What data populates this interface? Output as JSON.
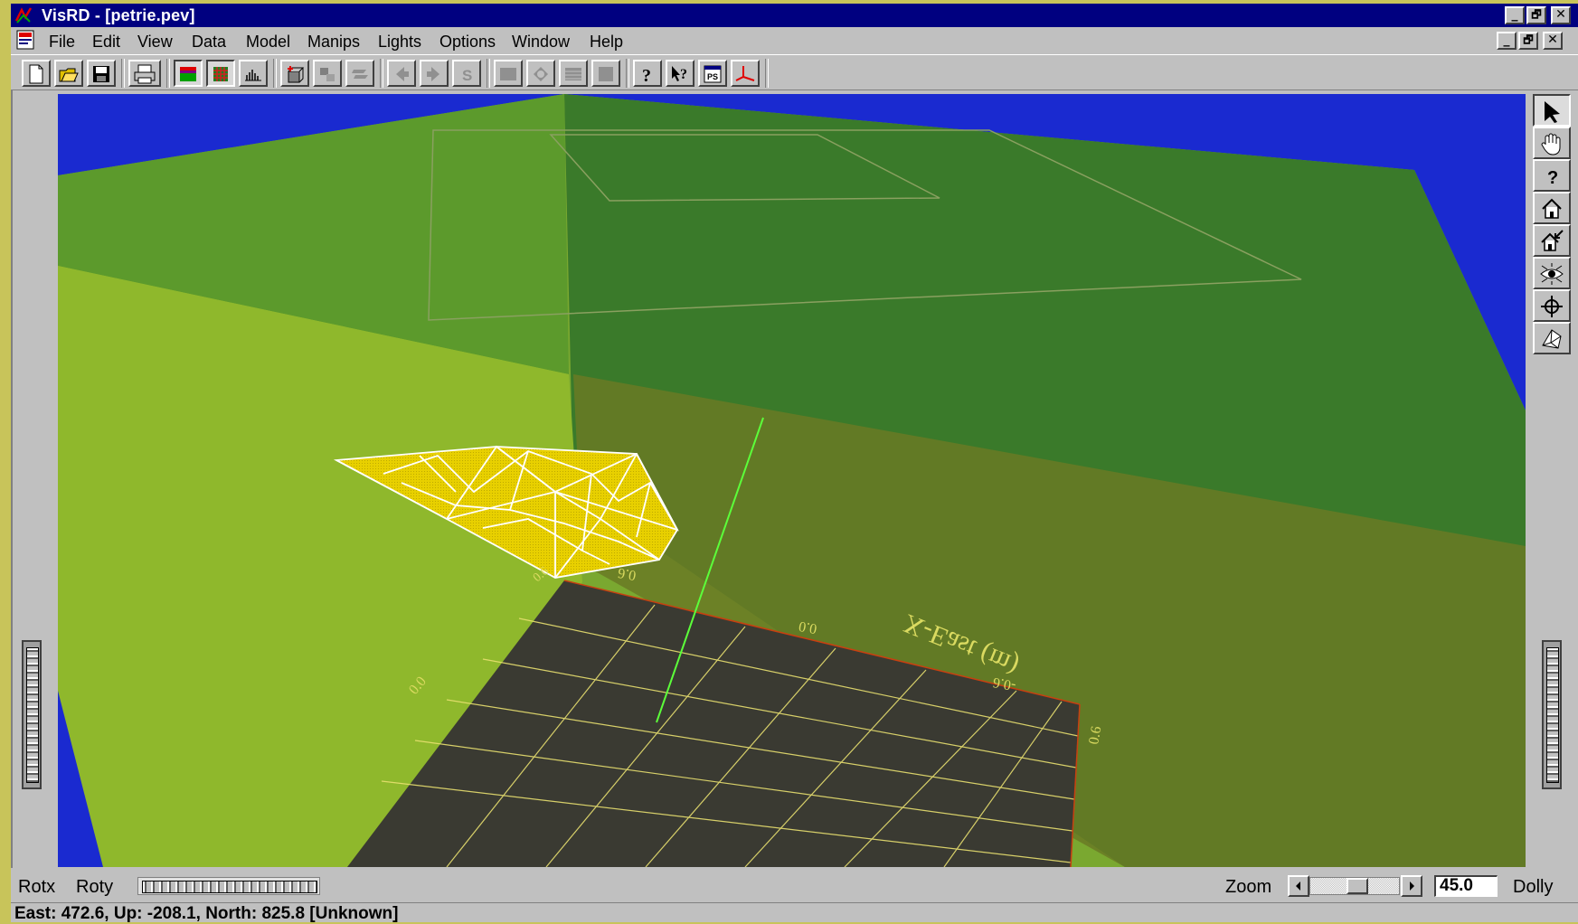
{
  "window": {
    "title": "VisRD - [petrie.pev]",
    "controls": [
      "_",
      "🗗",
      "✕"
    ]
  },
  "menubar": {
    "items": [
      "File",
      "Edit",
      "View",
      "Data",
      "Model",
      "Manips",
      "Lights",
      "Options",
      "Window",
      "Help"
    ],
    "doc_controls": [
      "_",
      "🗗",
      "✕"
    ]
  },
  "toolbar": {
    "buttons": [
      {
        "icon": "new-document-icon"
      },
      {
        "icon": "open-folder-icon"
      },
      {
        "icon": "save-disk-icon"
      },
      {
        "icon": "print-icon"
      },
      {
        "icon": "solid-render-icon",
        "pressed": true
      },
      {
        "icon": "textured-render-icon",
        "pressed": true
      },
      {
        "icon": "histogram-icon"
      },
      {
        "icon": "add-object-icon"
      },
      {
        "icon": "group-objects-icon"
      },
      {
        "icon": "stack-objects-icon"
      },
      {
        "icon": "step-back-icon"
      },
      {
        "icon": "step-forward-icon"
      },
      {
        "icon": "s-icon",
        "text": "S"
      },
      {
        "icon": "rectangle-icon"
      },
      {
        "icon": "shape-icon"
      },
      {
        "icon": "pattern-icon"
      },
      {
        "icon": "square-icon"
      },
      {
        "icon": "help-icon",
        "text": "?"
      },
      {
        "icon": "context-help-icon",
        "text": "?"
      },
      {
        "icon": "postscript-icon",
        "text": "PS"
      },
      {
        "icon": "axes-icon"
      }
    ]
  },
  "tools": [
    {
      "icon": "select-arrow-icon",
      "pressed": true
    },
    {
      "icon": "pan-hand-icon"
    },
    {
      "icon": "query-icon",
      "text": "?"
    },
    {
      "icon": "home-view-icon"
    },
    {
      "icon": "set-home-icon"
    },
    {
      "icon": "view-all-icon"
    },
    {
      "icon": "seek-crosshair-icon"
    },
    {
      "icon": "perspective-icon"
    }
  ],
  "scene": {
    "axis_title": "X-East (m)",
    "tick_labels": [
      "0.6",
      "0.0",
      "-0.6",
      "0.0",
      "0.6",
      "0.6"
    ],
    "colors": {
      "background": "#1a2ad0",
      "floor": "#8fb82c",
      "back_wall": "#3a7a2a",
      "grid_plane": "#3a3a32",
      "grid_lines": "#e8e070",
      "mesh_fill": "#e8d000",
      "mesh_edges": "#ffffff",
      "ray": "#5cff3a"
    }
  },
  "bottom": {
    "rotx_label": "Rotx",
    "roty_label": "Roty",
    "zoom_label": "Zoom",
    "zoom_value": "45.0",
    "dolly_label": "Dolly"
  },
  "status": {
    "text": "East: 472.6, Up: -208.1, North: 825.8 [Unknown]"
  }
}
